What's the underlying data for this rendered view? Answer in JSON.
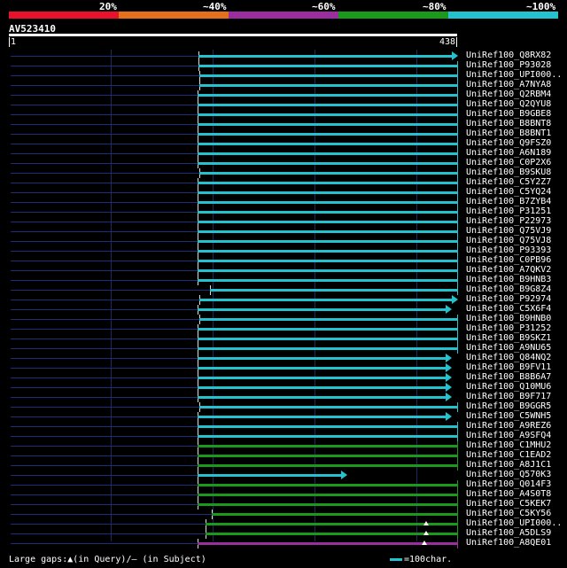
{
  "legend": {
    "labels": [
      "20%",
      "~40%",
      "~60%",
      "~80%",
      "~100%"
    ],
    "colors": [
      "#e8132a",
      "#e56f1c",
      "#9b2e9f",
      "#1a9a1a",
      "#22c3cf"
    ]
  },
  "query": {
    "name": "AV523410",
    "start": "1",
    "end": "438"
  },
  "hits": [
    {
      "name": "UniRef100_Q8RX82",
      "color": "#22c3cf",
      "from": 185,
      "to": 438,
      "arrow": true
    },
    {
      "name": "UniRef100_P93028",
      "color": "#22c3cf",
      "from": 185,
      "to": 438,
      "arrow": false
    },
    {
      "name": "UniRef100_UPI000..",
      "color": "#22c3cf",
      "from": 186,
      "to": 438,
      "arrow": false
    },
    {
      "name": "UniRef100_A7NYA8",
      "color": "#22c3cf",
      "from": 186,
      "to": 438,
      "arrow": false
    },
    {
      "name": "UniRef100_Q2RBM4",
      "color": "#22c3cf",
      "from": 184,
      "to": 438,
      "arrow": false
    },
    {
      "name": "UniRef100_Q2QYU8",
      "color": "#22c3cf",
      "from": 184,
      "to": 438,
      "arrow": false
    },
    {
      "name": "UniRef100_B9GBE8",
      "color": "#22c3cf",
      "from": 184,
      "to": 438,
      "arrow": false
    },
    {
      "name": "UniRef100_B8BNT8",
      "color": "#22c3cf",
      "from": 184,
      "to": 438,
      "arrow": false
    },
    {
      "name": "UniRef100_B8BNT1",
      "color": "#22c3cf",
      "from": 184,
      "to": 438,
      "arrow": false
    },
    {
      "name": "UniRef100_Q9FSZ0",
      "color": "#22c3cf",
      "from": 184,
      "to": 438,
      "arrow": false
    },
    {
      "name": "UniRef100_A6N189",
      "color": "#22c3cf",
      "from": 184,
      "to": 438,
      "arrow": false
    },
    {
      "name": "UniRef100_C0P2X6",
      "color": "#22c3cf",
      "from": 184,
      "to": 438,
      "arrow": false
    },
    {
      "name": "UniRef100_B9SKU8",
      "color": "#22c3cf",
      "from": 186,
      "to": 438,
      "arrow": false
    },
    {
      "name": "UniRef100_C5Y2Z7",
      "color": "#22c3cf",
      "from": 184,
      "to": 438,
      "arrow": false
    },
    {
      "name": "UniRef100_C5YQ24",
      "color": "#22c3cf",
      "from": 184,
      "to": 438,
      "arrow": false
    },
    {
      "name": "UniRef100_B7ZYB4",
      "color": "#22c3cf",
      "from": 184,
      "to": 438,
      "arrow": false
    },
    {
      "name": "UniRef100_P31251",
      "color": "#22c3cf",
      "from": 184,
      "to": 438,
      "arrow": false
    },
    {
      "name": "UniRef100_P22973",
      "color": "#22c3cf",
      "from": 184,
      "to": 438,
      "arrow": false
    },
    {
      "name": "UniRef100_Q75VJ9",
      "color": "#22c3cf",
      "from": 184,
      "to": 438,
      "arrow": false
    },
    {
      "name": "UniRef100_Q75VJ8",
      "color": "#22c3cf",
      "from": 184,
      "to": 438,
      "arrow": false
    },
    {
      "name": "UniRef100_P93393",
      "color": "#22c3cf",
      "from": 184,
      "to": 438,
      "arrow": false
    },
    {
      "name": "UniRef100_C0PB96",
      "color": "#22c3cf",
      "from": 184,
      "to": 438,
      "arrow": false
    },
    {
      "name": "UniRef100_A7QKV2",
      "color": "#22c3cf",
      "from": 184,
      "to": 438,
      "arrow": false
    },
    {
      "name": "UniRef100_B9HNB3",
      "color": "#22c3cf",
      "from": 184,
      "to": 438,
      "arrow": false
    },
    {
      "name": "UniRef100_B9G8Z4",
      "color": "#22c3cf",
      "from": 196,
      "to": 438,
      "arrow": false
    },
    {
      "name": "UniRef100_P92974",
      "color": "#22c3cf",
      "from": 186,
      "to": 438,
      "arrow": true
    },
    {
      "name": "UniRef100_C5X6F4",
      "color": "#22c3cf",
      "from": 184,
      "to": 432,
      "arrow": true
    },
    {
      "name": "UniRef100_B9HNB0",
      "color": "#22c3cf",
      "from": 186,
      "to": 438,
      "arrow": false
    },
    {
      "name": "UniRef100_P31252",
      "color": "#22c3cf",
      "from": 184,
      "to": 438,
      "arrow": false
    },
    {
      "name": "UniRef100_B9SKZ1",
      "color": "#22c3cf",
      "from": 184,
      "to": 438,
      "arrow": false
    },
    {
      "name": "UniRef100_A9NU65",
      "color": "#22c3cf",
      "from": 184,
      "to": 438,
      "arrow": false
    },
    {
      "name": "UniRef100_Q84NQ2",
      "color": "#22c3cf",
      "from": 184,
      "to": 432,
      "arrow": true
    },
    {
      "name": "UniRef100_B9FV11",
      "color": "#22c3cf",
      "from": 184,
      "to": 432,
      "arrow": true
    },
    {
      "name": "UniRef100_B8B6A7",
      "color": "#22c3cf",
      "from": 184,
      "to": 432,
      "arrow": true
    },
    {
      "name": "UniRef100_Q10MU6",
      "color": "#22c3cf",
      "from": 184,
      "to": 432,
      "arrow": true
    },
    {
      "name": "UniRef100_B9F717",
      "color": "#22c3cf",
      "from": 184,
      "to": 432,
      "arrow": true
    },
    {
      "name": "UniRef100_B9GGR5",
      "color": "#22c3cf",
      "from": 186,
      "to": 438,
      "arrow": false
    },
    {
      "name": "UniRef100_C5WNH5",
      "color": "#22c3cf",
      "from": 184,
      "to": 432,
      "arrow": true
    },
    {
      "name": "UniRef100_A9REZ6",
      "color": "#22c3cf",
      "from": 184,
      "to": 438,
      "arrow": false
    },
    {
      "name": "UniRef100_A9SFQ4",
      "color": "#22c3cf",
      "from": 184,
      "to": 438,
      "arrow": false
    },
    {
      "name": "UniRef100_C1MHU2",
      "color": "#1a9a1a",
      "from": 184,
      "to": 438,
      "arrow": false
    },
    {
      "name": "UniRef100_C1EAD2",
      "color": "#1a9a1a",
      "from": 184,
      "to": 438,
      "arrow": false
    },
    {
      "name": "UniRef100_A8J1C1",
      "color": "#1a9a1a",
      "from": 184,
      "to": 438,
      "arrow": false
    },
    {
      "name": "UniRef100_Q570K3",
      "color": "#22c3cf",
      "from": 184,
      "to": 330,
      "arrow": true
    },
    {
      "name": "UniRef100_Q014F3",
      "color": "#1a9a1a",
      "from": 184,
      "to": 438,
      "arrow": false
    },
    {
      "name": "UniRef100_A4S0T8",
      "color": "#1a9a1a",
      "from": 184,
      "to": 438,
      "arrow": false
    },
    {
      "name": "UniRef100_C5KEK7",
      "color": "#1a9a1a",
      "from": 184,
      "to": 438,
      "arrow": false
    },
    {
      "name": "UniRef100_C5KY56",
      "color": "#1a9a1a",
      "from": 198,
      "to": 438,
      "arrow": false
    },
    {
      "name": "UniRef100_UPI000..",
      "color": "#1a9a1a",
      "from": 192,
      "to": 438,
      "arrow": false,
      "gap": 408
    },
    {
      "name": "UniRef100_A5DLS9",
      "color": "#1a9a1a",
      "from": 192,
      "to": 438,
      "arrow": false,
      "gap": 408
    },
    {
      "name": "UniRef100_A8QE01",
      "color": "#9b2e9f",
      "from": 184,
      "to": 438,
      "arrow": false,
      "gap": 406
    }
  ],
  "footer": {
    "gaps_text": "Large gaps:▲(in Query)/– (in Subject)",
    "scale_text": "=100char."
  }
}
